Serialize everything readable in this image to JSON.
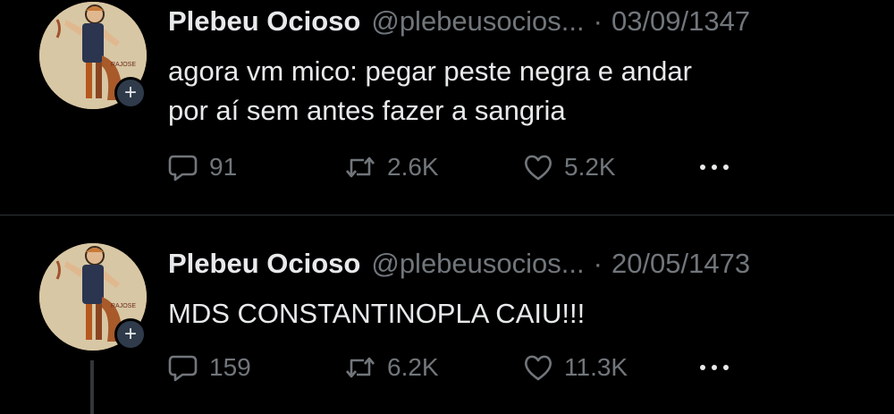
{
  "tweets": [
    {
      "name": "Plebeu Ocioso",
      "handle": "@plebeusocios...",
      "separator": "·",
      "date": "03/09/1347",
      "text_line1": "agora vm mico: pegar peste negra e andar",
      "text_line2": "por aí sem antes fazer a sangria",
      "replies": "91",
      "retweets": "2.6K",
      "likes": "5.2K",
      "avatar_caption": "RAJOSE"
    },
    {
      "name": "Plebeu Ocioso",
      "handle": "@plebeusocios...",
      "separator": "·",
      "date": "20/05/1473",
      "text_line1": "MDS CONSTANTINOPLA CAIU!!!",
      "replies": "159",
      "retweets": "6.2K",
      "likes": "11.3K",
      "avatar_caption": "RAJOSE"
    }
  ],
  "icons": {
    "reply": "reply-icon",
    "retweet": "retweet-icon",
    "like": "heart-icon",
    "more": "more-icon",
    "follow": "plus-icon"
  },
  "colors": {
    "background": "#000000",
    "text": "#e7e9ea",
    "muted": "#71767b",
    "divider": "#2f3336"
  }
}
